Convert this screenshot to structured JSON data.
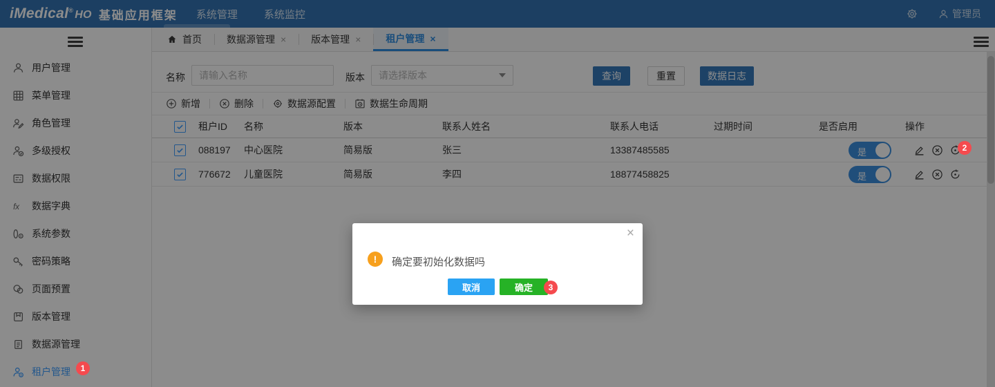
{
  "header": {
    "logo_main": "iMedical",
    "logo_reg": "®",
    "logo_suffix": "HO",
    "app_title": "基础应用框架",
    "menus": [
      {
        "label": "系统管理",
        "active": true
      },
      {
        "label": "系统监控",
        "active": false
      }
    ],
    "user_name": "管理员"
  },
  "sidebar": {
    "items": [
      {
        "label": "用户管理",
        "icon": "user-icon"
      },
      {
        "label": "菜单管理",
        "icon": "menu-grid-icon"
      },
      {
        "label": "角色管理",
        "icon": "role-icon"
      },
      {
        "label": "多级授权",
        "icon": "user-check-icon"
      },
      {
        "label": "数据权限",
        "icon": "data-permission-icon"
      },
      {
        "label": "数据字典",
        "icon": "fx-icon"
      },
      {
        "label": "系统参数",
        "icon": "parameter-icon"
      },
      {
        "label": "密码策略",
        "icon": "key-icon"
      },
      {
        "label": "页面预置",
        "icon": "pages-icon"
      },
      {
        "label": "版本管理",
        "icon": "version-icon"
      },
      {
        "label": "数据源管理",
        "icon": "datasource-icon"
      },
      {
        "label": "租户管理",
        "icon": "tenant-icon",
        "active": true,
        "badge": "1"
      }
    ]
  },
  "tabs": [
    {
      "label": "首页",
      "icon": "home-icon",
      "closable": false,
      "active": false
    },
    {
      "label": "数据源管理",
      "closable": true,
      "active": false
    },
    {
      "label": "版本管理",
      "closable": true,
      "active": false
    },
    {
      "label": "租户管理",
      "closable": true,
      "active": true
    }
  ],
  "search": {
    "name_label": "名称",
    "name_placeholder": "请输入名称",
    "version_label": "版本",
    "version_placeholder": "请选择版本",
    "query_label": "查询",
    "reset_label": "重置",
    "data_log_label": "数据日志"
  },
  "toolbar": {
    "add_label": "新增",
    "delete_label": "删除",
    "datasource_config_label": "数据源配置",
    "lifecycle_label": "数据生命周期"
  },
  "table": {
    "columns": [
      "租户ID",
      "名称",
      "版本",
      "联系人姓名",
      "联系人电话",
      "过期时间",
      "是否启用",
      "操作"
    ],
    "rows": [
      {
        "id": "088197",
        "name": "中心医院",
        "version": "简易版",
        "contact": "张三",
        "phone": "13387485585",
        "expire": "",
        "enabled": "是",
        "badge": "2"
      },
      {
        "id": "776672",
        "name": "儿童医院",
        "version": "简易版",
        "contact": "李四",
        "phone": "18877458825",
        "expire": "",
        "enabled": "是"
      }
    ]
  },
  "dialog": {
    "message": "确定要初始化数据吗",
    "cancel_label": "取消",
    "confirm_label": "确定",
    "badge": "3"
  },
  "colors": {
    "header_bg": "#3374b3",
    "accent_blue": "#409eff",
    "tab_active": "#2f8ce0",
    "button_blue": "#3579bb",
    "toggle_blue": "#3b8ede",
    "dialog_cancel_blue": "#2aa3f3",
    "dialog_confirm_green": "#26b226",
    "badge_red": "#f54a4e",
    "warning_orange": "#f7a01d"
  }
}
